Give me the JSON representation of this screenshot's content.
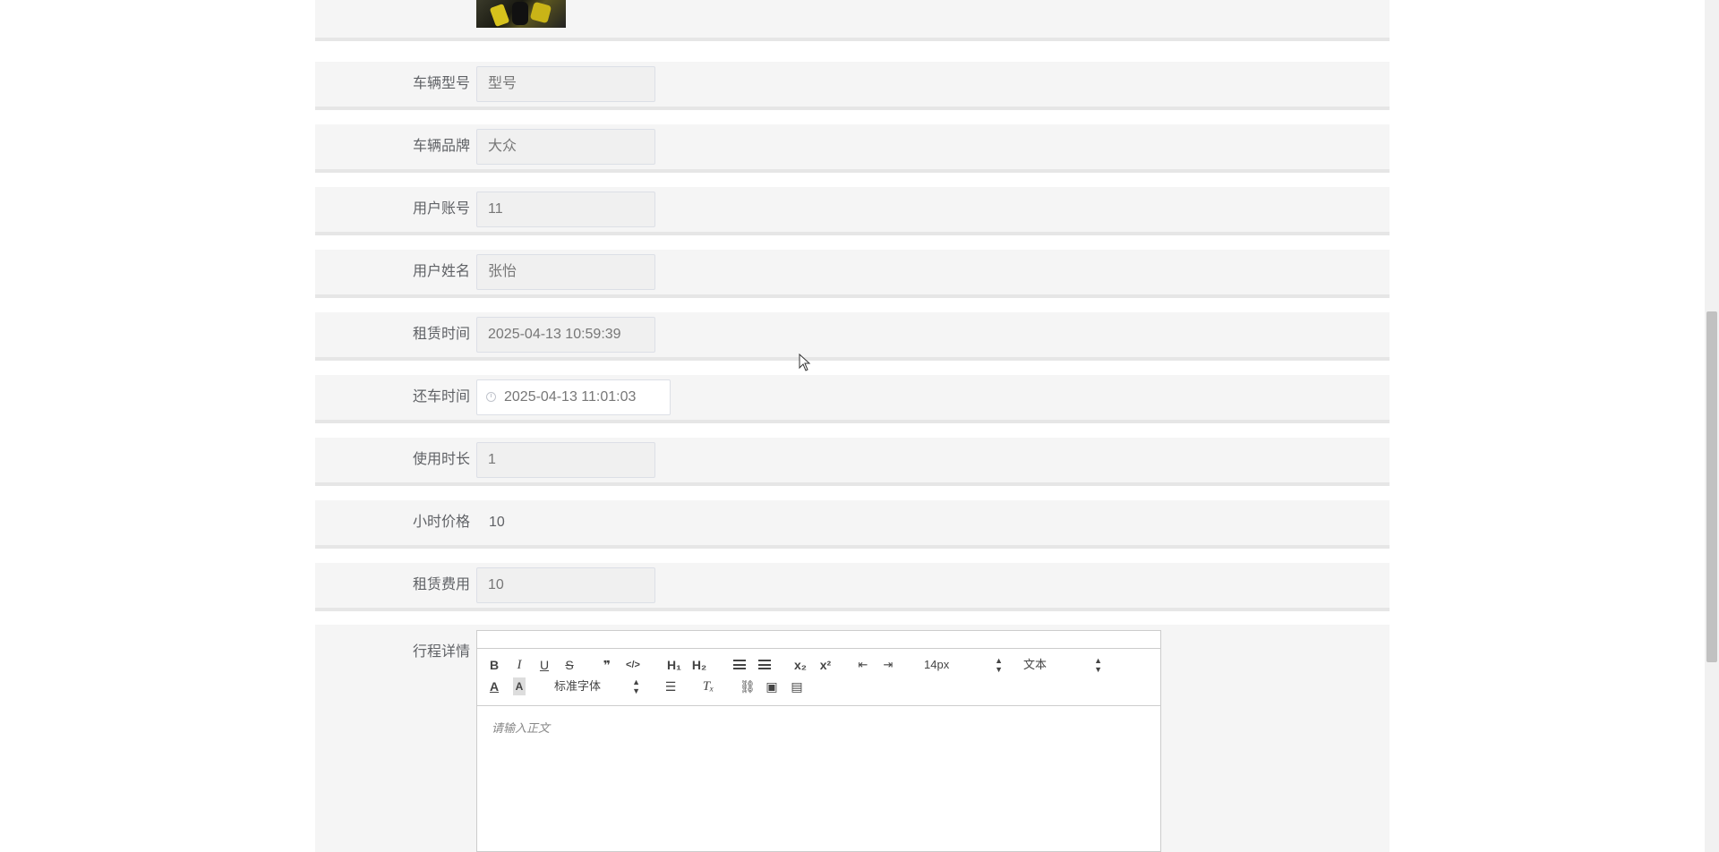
{
  "fields": [
    {
      "key": "model",
      "label": "车辆型号",
      "value": "型号"
    },
    {
      "key": "brand",
      "label": "车辆品牌",
      "value": "大众"
    },
    {
      "key": "account",
      "label": "用户账号",
      "value": "11"
    },
    {
      "key": "name",
      "label": "用户姓名",
      "value": "张怡"
    },
    {
      "key": "rent_time",
      "label": "租赁时间",
      "value": "2025-04-13 10:59:39"
    },
    {
      "key": "return_time",
      "label": "还车时间",
      "value": "2025-04-13 11:01:03"
    },
    {
      "key": "duration",
      "label": "使用时长",
      "value": "1"
    },
    {
      "key": "hour_price",
      "label": "小时价格",
      "value": "10"
    },
    {
      "key": "fee",
      "label": "租赁费用",
      "value": "10"
    }
  ],
  "editor": {
    "label": "行程详情",
    "placeholder": "请输入正文",
    "font_size": "14px",
    "paragraph": "文本",
    "font_family": "标准字体",
    "toolbar": {
      "bold": "B",
      "italic": "I",
      "underline": "U",
      "strike": "S",
      "quote": "❞",
      "code": "</>",
      "h1": "H₁",
      "h2": "H₂",
      "sub": "x₂",
      "sup": "x²",
      "color": "A",
      "bg": "A",
      "clean": "Tₓ"
    }
  }
}
